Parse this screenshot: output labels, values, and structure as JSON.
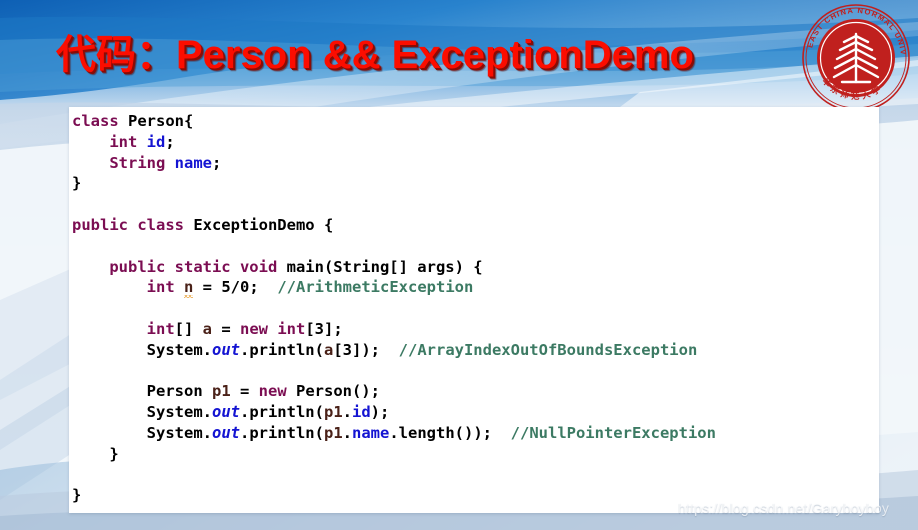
{
  "slide": {
    "title_cjk": "代码：",
    "title_latin": "Person && ExceptionDemo",
    "title_color": "#fc0d00",
    "title_shadow_color": "#8a0b05"
  },
  "logo": {
    "name": "east-china-normal-university-seal",
    "outer_text": "EAST CHINA NORMAL UNIVERSITY",
    "inner_text_cjk": "华东师范大学",
    "color": "#c0201e"
  },
  "code": {
    "language": "java",
    "colors": {
      "keyword": "#7b0d52",
      "field": "#1414d2",
      "local_variable": "#4a2118",
      "comment": "#3c7a63",
      "plain": "#000000",
      "warning_underline": "#e8a33d",
      "background": "#ffffff"
    },
    "lines": [
      {
        "id": "l1",
        "indent": 0,
        "tokens": [
          {
            "t": "class",
            "c": "kw"
          },
          {
            "t": " Person{",
            "c": "plain"
          }
        ]
      },
      {
        "id": "l2",
        "indent": 1,
        "tokens": [
          {
            "t": "int",
            "c": "kw"
          },
          {
            "t": " ",
            "c": "plain"
          },
          {
            "t": "id",
            "c": "fld"
          },
          {
            "t": ";",
            "c": "plain"
          }
        ]
      },
      {
        "id": "l3",
        "indent": 1,
        "tokens": [
          {
            "t": "String",
            "c": "kw"
          },
          {
            "t": " ",
            "c": "plain"
          },
          {
            "t": "name",
            "c": "fld"
          },
          {
            "t": ";",
            "c": "plain"
          }
        ]
      },
      {
        "id": "l4",
        "indent": 0,
        "tokens": [
          {
            "t": "}",
            "c": "plain"
          }
        ]
      },
      {
        "id": "l5",
        "indent": 0,
        "tokens": []
      },
      {
        "id": "l6",
        "indent": 0,
        "tokens": [
          {
            "t": "public class",
            "c": "kw"
          },
          {
            "t": " ExceptionDemo {",
            "c": "plain"
          }
        ]
      },
      {
        "id": "l7",
        "indent": 0,
        "tokens": []
      },
      {
        "id": "l8",
        "indent": 1,
        "tokens": [
          {
            "t": "public static void",
            "c": "kw"
          },
          {
            "t": " main(String[] args) {",
            "c": "plain"
          }
        ]
      },
      {
        "id": "l9",
        "indent": 2,
        "tokens": [
          {
            "t": "int",
            "c": "kw"
          },
          {
            "t": " ",
            "c": "plain"
          },
          {
            "t": "n",
            "c": "warn"
          },
          {
            "t": " = 5/0;  ",
            "c": "plain"
          },
          {
            "t": "//ArithmeticException",
            "c": "cmt"
          }
        ]
      },
      {
        "id": "l10",
        "indent": 0,
        "tokens": []
      },
      {
        "id": "l11",
        "indent": 2,
        "tokens": [
          {
            "t": "int",
            "c": "kw"
          },
          {
            "t": "[] ",
            "c": "plain"
          },
          {
            "t": "a",
            "c": "var"
          },
          {
            "t": " = ",
            "c": "plain"
          },
          {
            "t": "new int",
            "c": "kw"
          },
          {
            "t": "[3];",
            "c": "plain"
          }
        ]
      },
      {
        "id": "l12",
        "indent": 2,
        "tokens": [
          {
            "t": "System.",
            "c": "plain"
          },
          {
            "t": "out",
            "c": "fld-i"
          },
          {
            "t": ".println(",
            "c": "plain"
          },
          {
            "t": "a",
            "c": "var"
          },
          {
            "t": "[3]);  ",
            "c": "plain"
          },
          {
            "t": "//ArrayIndexOutOfBoundsException",
            "c": "cmt"
          }
        ]
      },
      {
        "id": "l13",
        "indent": 0,
        "tokens": []
      },
      {
        "id": "l14",
        "indent": 2,
        "tokens": [
          {
            "t": "Person ",
            "c": "plain"
          },
          {
            "t": "p1",
            "c": "var"
          },
          {
            "t": " = ",
            "c": "plain"
          },
          {
            "t": "new",
            "c": "kw"
          },
          {
            "t": " Person();",
            "c": "plain"
          }
        ]
      },
      {
        "id": "l15",
        "indent": 2,
        "tokens": [
          {
            "t": "System.",
            "c": "plain"
          },
          {
            "t": "out",
            "c": "fld-i"
          },
          {
            "t": ".println(",
            "c": "plain"
          },
          {
            "t": "p1",
            "c": "var"
          },
          {
            "t": ".",
            "c": "plain"
          },
          {
            "t": "id",
            "c": "fld"
          },
          {
            "t": ");",
            "c": "plain"
          }
        ]
      },
      {
        "id": "l16",
        "indent": 2,
        "tokens": [
          {
            "t": "System.",
            "c": "plain"
          },
          {
            "t": "out",
            "c": "fld-i"
          },
          {
            "t": ".println(",
            "c": "plain"
          },
          {
            "t": "p1",
            "c": "var"
          },
          {
            "t": ".",
            "c": "plain"
          },
          {
            "t": "name",
            "c": "fld"
          },
          {
            "t": ".length());  ",
            "c": "plain"
          },
          {
            "t": "//NullPointerException",
            "c": "cmt"
          }
        ]
      },
      {
        "id": "l17",
        "indent": 1,
        "tokens": [
          {
            "t": "}",
            "c": "plain"
          }
        ]
      },
      {
        "id": "l18",
        "indent": 0,
        "tokens": []
      },
      {
        "id": "l19",
        "indent": 0,
        "tokens": [
          {
            "t": "}",
            "c": "plain"
          }
        ]
      }
    ]
  },
  "watermark": {
    "text": "https://blog.csdn.net/Garyboyboy"
  }
}
